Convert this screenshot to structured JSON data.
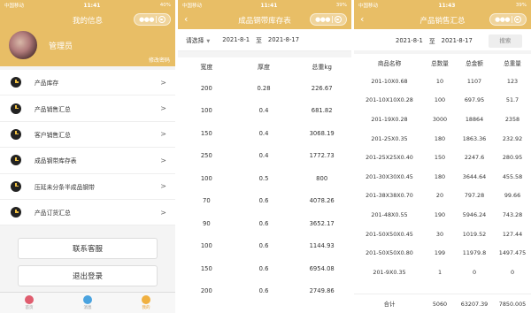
{
  "panels": {
    "left": {
      "status": {
        "carrier": "中国移动 ",
        "time": "11:41",
        "battery": "40%"
      },
      "title": "我的信息",
      "username": "管理员",
      "edit_password": "修改密码",
      "menu": [
        {
          "label": "产品库存",
          "arrow": ">"
        },
        {
          "label": "产品销售汇总",
          "arrow": ">"
        },
        {
          "label": "客户销售汇总",
          "arrow": ">"
        },
        {
          "label": "成品钢带库存表",
          "arrow": ">"
        },
        {
          "label": "压延未分条半成品钢带",
          "arrow": ">"
        },
        {
          "label": "产品订货汇总",
          "arrow": ">"
        }
      ],
      "contact_button": "联系客服",
      "logout_button": "退出登录",
      "tabs": [
        {
          "label": "首页",
          "color": "#e05d6f"
        },
        {
          "label": "消息",
          "color": "#4aa3df"
        },
        {
          "label": "我的",
          "color": "#f0b040"
        }
      ]
    },
    "middle": {
      "status": {
        "carrier": "中国移动 ",
        "time": "11:41",
        "battery": "39%"
      },
      "title": "成品钢带库存表",
      "filter": {
        "select_label": "请选择",
        "caret": "▼",
        "date_from": "2021-8-1",
        "to": "至",
        "date_to": "2021-8-17"
      },
      "columns": [
        "宽度",
        "厚度",
        "总重kg"
      ],
      "rows": [
        [
          "200",
          "0.28",
          "226.67"
        ],
        [
          "100",
          "0.4",
          "681.82"
        ],
        [
          "150",
          "0.4",
          "3068.19"
        ],
        [
          "250",
          "0.4",
          "1772.73"
        ],
        [
          "100",
          "0.5",
          "800"
        ],
        [
          "70",
          "0.6",
          "4078.26"
        ],
        [
          "90",
          "0.6",
          "3652.17"
        ],
        [
          "100",
          "0.6",
          "1144.93"
        ],
        [
          "150",
          "0.6",
          "6954.08"
        ],
        [
          "200",
          "0.6",
          "2749.86"
        ]
      ]
    },
    "right": {
      "status": {
        "carrier": "中国移动 ",
        "time": "11:43",
        "battery": "39%"
      },
      "title": "产品销售汇总",
      "filter": {
        "date_from": "2021-8-1",
        "to": "至",
        "date_to": "2021-8-17",
        "search": "搜索"
      },
      "columns": [
        "商品名称",
        "总数量",
        "总金额",
        "总重量"
      ],
      "rows": [
        [
          "201-10X0.68",
          "10",
          "1107",
          "123"
        ],
        [
          "201-10X10X0.28",
          "100",
          "697.95",
          "51.7"
        ],
        [
          "201-19X0.28",
          "3000",
          "18864",
          "2358"
        ],
        [
          "201-25X0.35",
          "180",
          "1863.36",
          "232.92"
        ],
        [
          "201-25X25X0.40",
          "150",
          "2247.6",
          "280.95"
        ],
        [
          "201-30X30X0.45",
          "180",
          "3644.64",
          "455.58"
        ],
        [
          "201-38X38X0.70",
          "20",
          "797.28",
          "99.66"
        ],
        [
          "201-48X0.55",
          "190",
          "5946.24",
          "743.28"
        ],
        [
          "201-50X50X0.45",
          "30",
          "1019.52",
          "127.44"
        ],
        [
          "201-50X50X0.80",
          "199",
          "11979.8",
          "1497.475"
        ],
        [
          "201-9X0.35",
          "1",
          "0",
          "0"
        ]
      ],
      "total": {
        "label": "合计",
        "qty": "5060",
        "amount": "63207.39",
        "weight": "7850.005"
      }
    }
  }
}
